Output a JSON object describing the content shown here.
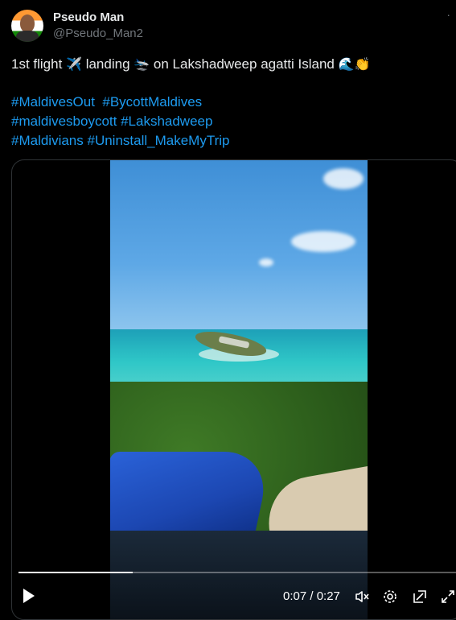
{
  "author": {
    "name": "Pseudo Man",
    "handle": "@Pseudo_Man2"
  },
  "tweet": {
    "line1_pre": "1st flight",
    "line1_mid": "landing",
    "line1_post": "on Lakshadweep agatti Island",
    "emoji_plane": "✈️",
    "emoji_landing": "🛬",
    "emoji_wave": "🌊",
    "emoji_clap": "👏",
    "hashtags": [
      [
        "#MaldivesOut",
        "#BycottMaldives"
      ],
      [
        "#maldivesboycott",
        "#Lakshadweep"
      ],
      [
        "#Maldivians",
        "#Uninstall_MakeMyTrip"
      ]
    ]
  },
  "video": {
    "current_time": "0:07",
    "duration": "0:27",
    "time_display": "0:07 / 0:27",
    "progress": 0.26
  },
  "icons": {
    "more": "more-icon",
    "play": "play-icon",
    "mute": "mute-icon",
    "settings": "gear-icon",
    "pip": "pip-icon",
    "fullscreen": "fullscreen-icon"
  },
  "colors": {
    "link": "#1d9bf0",
    "text": "#e7e9ea",
    "muted": "#71767b",
    "background": "#000000"
  }
}
